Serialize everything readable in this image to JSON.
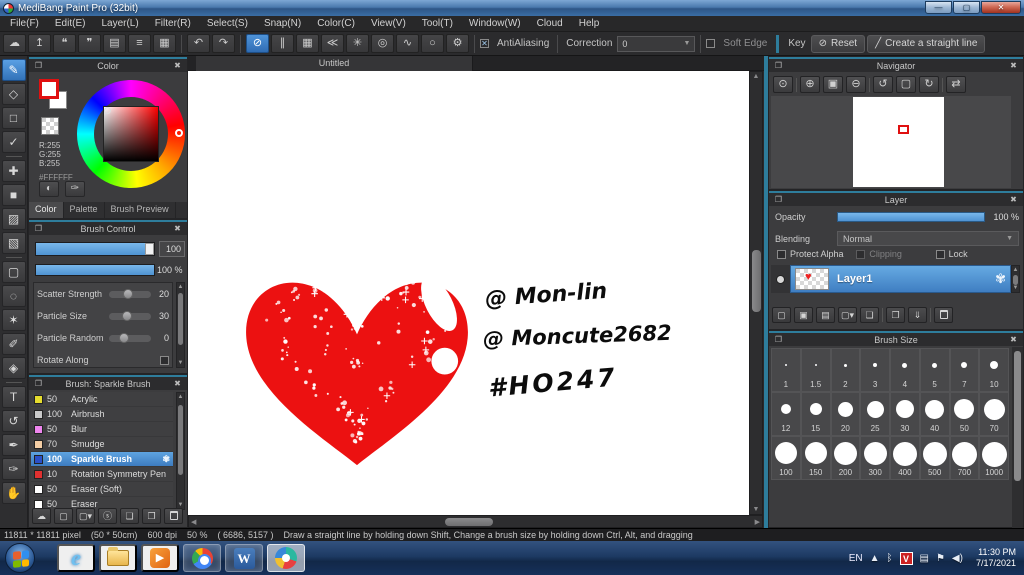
{
  "window": {
    "title": "MediBang Paint Pro (32bit)",
    "minimize": "—",
    "maximize": "▢",
    "close": "✕"
  },
  "menu": [
    "File(F)",
    "Edit(E)",
    "Layer(L)",
    "Filter(R)",
    "Select(S)",
    "Snap(N)",
    "Color(C)",
    "View(V)",
    "Tool(T)",
    "Window(W)",
    "Cloud",
    "Help"
  ],
  "toolbar": {
    "file_icons": [
      {
        "name": "cloud-icon",
        "glyph": "☁"
      },
      {
        "name": "publish-icon",
        "glyph": "↥"
      },
      {
        "name": "comment-icon",
        "glyph": "❝"
      },
      {
        "name": "chat-icon",
        "glyph": "❞"
      },
      {
        "name": "document-icon",
        "glyph": "▤"
      },
      {
        "name": "list-icon",
        "glyph": "≡"
      },
      {
        "name": "grid-icon",
        "glyph": "▦"
      }
    ],
    "history_icons": [
      {
        "name": "undo-icon",
        "glyph": "↶"
      },
      {
        "name": "redo-icon",
        "glyph": "↷"
      }
    ],
    "snap_icons": [
      {
        "name": "snap-off-icon",
        "glyph": "⊘",
        "active": true
      },
      {
        "name": "snap-parallel-icon",
        "glyph": "∥"
      },
      {
        "name": "snap-grid-icon",
        "glyph": "▦"
      },
      {
        "name": "snap-vanishing-point-icon",
        "glyph": "≪"
      },
      {
        "name": "snap-radial-icon",
        "glyph": "✳"
      },
      {
        "name": "snap-concentric-icon",
        "glyph": "◎"
      },
      {
        "name": "snap-curve-icon",
        "glyph": "∿"
      },
      {
        "name": "snap-ellipse-icon",
        "glyph": "○"
      },
      {
        "name": "snap-settings-icon",
        "glyph": "⚙"
      }
    ],
    "antialiasing_label": "AntiAliasing",
    "correction_label": "Correction",
    "correction_value": "0",
    "soft_edge_label": "Soft Edge",
    "key_label": "Key",
    "reset_label": "Reset",
    "straight_line_label": "Create a straight line"
  },
  "tools": [
    {
      "name": "brush-tool",
      "glyph": "✎",
      "active": true
    },
    {
      "name": "eraser-tool",
      "glyph": "◇"
    },
    {
      "name": "shape-brush-tool",
      "glyph": "□"
    },
    {
      "name": "line-tool",
      "glyph": "✓"
    },
    {
      "name": "divider",
      "divider": true
    },
    {
      "name": "move-tool",
      "glyph": "✚"
    },
    {
      "name": "fill-rect-tool",
      "glyph": "■"
    },
    {
      "name": "bucket-tool",
      "glyph": "▨"
    },
    {
      "name": "gradient-tool",
      "glyph": "▧"
    },
    {
      "name": "divider",
      "divider": true
    },
    {
      "name": "select-rect-tool",
      "glyph": "▢"
    },
    {
      "name": "lasso-tool",
      "glyph": "◌"
    },
    {
      "name": "magic-wand-tool",
      "glyph": "✶"
    },
    {
      "name": "select-pen-tool",
      "glyph": "✐"
    },
    {
      "name": "select-eraser-tool",
      "glyph": "◈"
    },
    {
      "name": "divider",
      "divider": true
    },
    {
      "name": "text-tool",
      "glyph": "T"
    },
    {
      "name": "transform-tool",
      "glyph": "↺"
    },
    {
      "name": "pen-tool",
      "glyph": "✒"
    },
    {
      "name": "eyedropper-tool",
      "glyph": "✑"
    },
    {
      "name": "hand-tool",
      "glyph": "✋"
    }
  ],
  "color_panel": {
    "title": "Color",
    "r": "R:255",
    "g": "G:255",
    "b": "B:255",
    "hex": "#FFFFFF",
    "palette_button": "◐",
    "picker_button": "✑",
    "tabs": [
      "Color",
      "Palette",
      "Brush Preview"
    ],
    "active_tab": "Color"
  },
  "brush_control": {
    "title": "Brush Control",
    "size_value": "100",
    "opacity_value": "100 %",
    "params": [
      {
        "label": "Scatter Strength",
        "value": "20",
        "fill": 34
      },
      {
        "label": "Particle Size",
        "value": "30",
        "fill": 30
      },
      {
        "label": "Particle Random",
        "value": "0",
        "fill": 24
      },
      {
        "label": "Rotate Along",
        "value": "",
        "fill": -1
      }
    ]
  },
  "brush_panel": {
    "title": "Brush: Sparkle Brush",
    "brushes": [
      {
        "size": "50",
        "name": "Acrylic",
        "color": "#e6dd2e"
      },
      {
        "size": "100",
        "name": "Airbrush",
        "color": "#c9c9c9"
      },
      {
        "size": "50",
        "name": "Blur",
        "color": "#ee86ee"
      },
      {
        "size": "70",
        "name": "Smudge",
        "color": "#f3cda4"
      },
      {
        "size": "100",
        "name": "Sparkle Brush",
        "color": "#2b50c8",
        "selected": true
      },
      {
        "size": "10",
        "name": "Rotation Symmetry Pen",
        "color": "#e03030"
      },
      {
        "size": "50",
        "name": "Eraser (Soft)",
        "color": "#ffffff"
      },
      {
        "size": "50",
        "name": "Eraser",
        "color": "#ffffff"
      }
    ],
    "buttons": [
      {
        "name": "upload-brush-icon",
        "glyph": "☁"
      },
      {
        "name": "new-brush-icon",
        "glyph": "▢"
      },
      {
        "name": "new-brush-menu-icon",
        "glyph": "▢▾"
      },
      {
        "name": "script-brush-icon",
        "glyph": "ⓢ"
      },
      {
        "name": "brush-folder-icon",
        "glyph": "❏"
      },
      {
        "name": "duplicate-brush-icon",
        "glyph": "❐"
      },
      {
        "name": "delete-brush-icon",
        "glyph": "",
        "trash": true
      }
    ]
  },
  "canvas": {
    "tab": "Untitled",
    "annotations": [
      "@ Mon-lin",
      "@ Moncute2682",
      "#HO247"
    ],
    "heart_color": "#ec1111"
  },
  "navigator": {
    "title": "Navigator",
    "icons": [
      {
        "name": "zoom-actual-icon",
        "glyph": "⊙"
      },
      {
        "name": "divider",
        "divider": true
      },
      {
        "name": "zoom-in-icon",
        "glyph": "⊕"
      },
      {
        "name": "fit-screen-icon",
        "glyph": "▣"
      },
      {
        "name": "zoom-out-icon",
        "glyph": "⊖"
      },
      {
        "name": "divider",
        "divider": true
      },
      {
        "name": "rotate-left-icon",
        "glyph": "↺"
      },
      {
        "name": "reset-rotation-icon",
        "glyph": "▢"
      },
      {
        "name": "rotate-right-icon",
        "glyph": "↻"
      },
      {
        "name": "divider",
        "divider": true
      },
      {
        "name": "flip-canvas-icon",
        "glyph": "⇄"
      }
    ]
  },
  "layer_panel": {
    "title": "Layer",
    "opacity_label": "Opacity",
    "opacity_value": "100 %",
    "blending_label": "Blending",
    "blending_value": "Normal",
    "checkboxes": [
      {
        "label": "Protect Alpha",
        "dim": false
      },
      {
        "label": "Clipping",
        "dim": true
      },
      {
        "label": "Lock",
        "dim": false
      }
    ],
    "layer_name": "Layer1",
    "buttons": [
      {
        "name": "new-layer-icon",
        "glyph": "▢"
      },
      {
        "name": "new-halftone-layer-icon",
        "glyph": "▣"
      },
      {
        "name": "new-1bit-layer-icon",
        "glyph": "▤"
      },
      {
        "name": "add-layer-menu-icon",
        "glyph": "▢▾"
      },
      {
        "name": "layer-folder-icon",
        "glyph": "❏"
      },
      {
        "name": "divider",
        "divider": true
      },
      {
        "name": "duplicate-layer-icon",
        "glyph": "❐"
      },
      {
        "name": "merge-layer-icon",
        "glyph": "⇓"
      },
      {
        "name": "divider",
        "divider": true
      },
      {
        "name": "delete-layer-icon",
        "glyph": "",
        "trash": true
      }
    ]
  },
  "brush_size_panel": {
    "title": "Brush Size",
    "cells": [
      {
        "label": "1",
        "dot": 2
      },
      {
        "label": "1.5",
        "dot": 2
      },
      {
        "label": "2",
        "dot": 3
      },
      {
        "label": "3",
        "dot": 4
      },
      {
        "label": "4",
        "dot": 5
      },
      {
        "label": "5",
        "dot": 5
      },
      {
        "label": "7",
        "dot": 6
      },
      {
        "label": "10",
        "dot": 8
      },
      {
        "label": "12",
        "dot": 10
      },
      {
        "label": "15",
        "dot": 12
      },
      {
        "label": "20",
        "dot": 15
      },
      {
        "label": "25",
        "dot": 17
      },
      {
        "label": "30",
        "dot": 18
      },
      {
        "label": "40",
        "dot": 19
      },
      {
        "label": "50",
        "dot": 20
      },
      {
        "label": "70",
        "dot": 21
      },
      {
        "label": "100",
        "dot": 22
      },
      {
        "label": "150",
        "dot": 22
      },
      {
        "label": "200",
        "dot": 23
      },
      {
        "label": "300",
        "dot": 23
      },
      {
        "label": "400",
        "dot": 24
      },
      {
        "label": "500",
        "dot": 24
      },
      {
        "label": "700",
        "dot": 25
      },
      {
        "label": "1000",
        "dot": 25
      }
    ]
  },
  "status_bar": {
    "dimensions": "11811 * 11811 pixel",
    "size_cm": "(50 * 50cm)",
    "dpi": "600 dpi",
    "zoom": "50 %",
    "coordinates": "( 6686, 5157 )",
    "hint": "Draw a straight line by holding down Shift, Change a brush size by holding down Ctrl, Alt, and dragging"
  },
  "taskbar": {
    "apps": [
      {
        "name": "internet-explorer",
        "icon": "ie",
        "glyph": "e",
        "state": ""
      },
      {
        "name": "windows-explorer",
        "icon": "folder",
        "glyph": "",
        "state": ""
      },
      {
        "name": "media-player",
        "icon": "wmp",
        "glyph": "▶",
        "state": ""
      },
      {
        "name": "chrome",
        "icon": "chrome",
        "glyph": "",
        "state": "active"
      },
      {
        "name": "word",
        "icon": "word",
        "glyph": "W",
        "state": "active"
      },
      {
        "name": "medibang",
        "icon": "medibang",
        "glyph": "",
        "state": "focused"
      }
    ],
    "tray": {
      "language": "EN",
      "icons": [
        {
          "name": "show-hidden-icon",
          "glyph": "▲"
        },
        {
          "name": "bluetooth-icon",
          "glyph": "ᛒ"
        },
        {
          "name": "antivirus-icon",
          "glyph": "V",
          "vbox": true
        },
        {
          "name": "clipboard-icon",
          "glyph": "▤"
        },
        {
          "name": "action-center-icon",
          "glyph": "⚑"
        },
        {
          "name": "volume-icon",
          "glyph": "◀)"
        }
      ],
      "time": "11:30 PM",
      "date": "7/17/2021"
    }
  },
  "colors": {
    "accent_blue": "#4f93d2",
    "selection_blue": "#4a8fd4",
    "heart_red": "#ec1111",
    "panel_header_line": "#2e7d9c"
  }
}
